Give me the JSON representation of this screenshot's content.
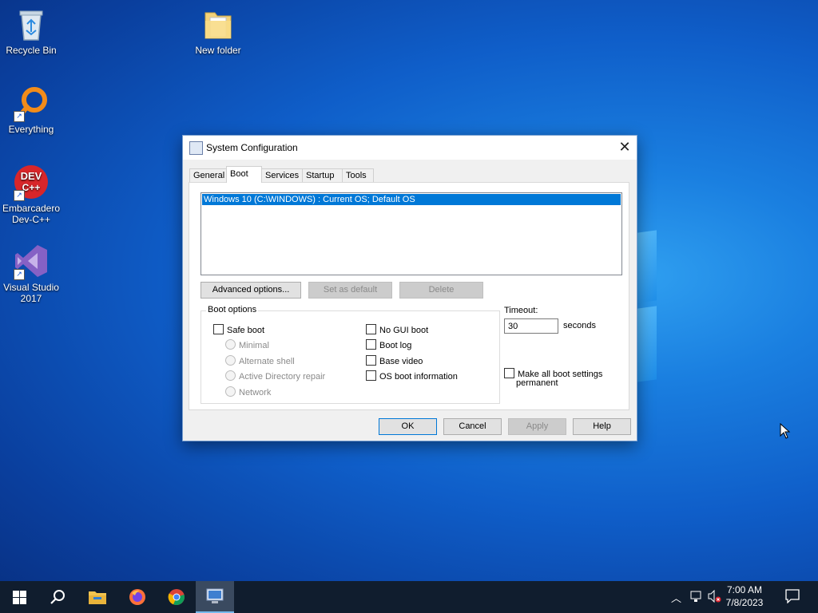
{
  "desktop": {
    "icons": [
      {
        "label": "Recycle Bin"
      },
      {
        "label": "New folder"
      },
      {
        "label": "Everything"
      },
      {
        "label": "Embarcadero Dev-C++"
      },
      {
        "label": "Visual Studio 2017"
      }
    ]
  },
  "dialog": {
    "title": "System Configuration",
    "close_glyph": "✕",
    "tabs": [
      "General",
      "Boot",
      "Services",
      "Startup",
      "Tools"
    ],
    "active_tab": "Boot",
    "os_list": [
      "Windows 10 (C:\\WINDOWS) : Current OS; Default OS"
    ],
    "buttons": {
      "advanced": "Advanced options...",
      "set_default": "Set as default",
      "delete": "Delete"
    },
    "boot_options": {
      "label": "Boot options",
      "safe_boot": "Safe boot",
      "minimal": "Minimal",
      "alternate_shell": "Alternate shell",
      "ad_repair": "Active Directory repair",
      "network": "Network",
      "no_gui_boot": "No GUI boot",
      "boot_log": "Boot log",
      "base_video": "Base video",
      "os_boot_info": "OS boot information"
    },
    "timeout": {
      "label": "Timeout:",
      "value": "30",
      "unit": "seconds"
    },
    "make_permanent": {
      "line1": "Make all boot settings",
      "line2": "permanent"
    },
    "footer": {
      "ok": "OK",
      "cancel": "Cancel",
      "apply": "Apply",
      "help": "Help"
    }
  },
  "taskbar": {
    "time": "7:00 AM",
    "date": "7/8/2023"
  }
}
